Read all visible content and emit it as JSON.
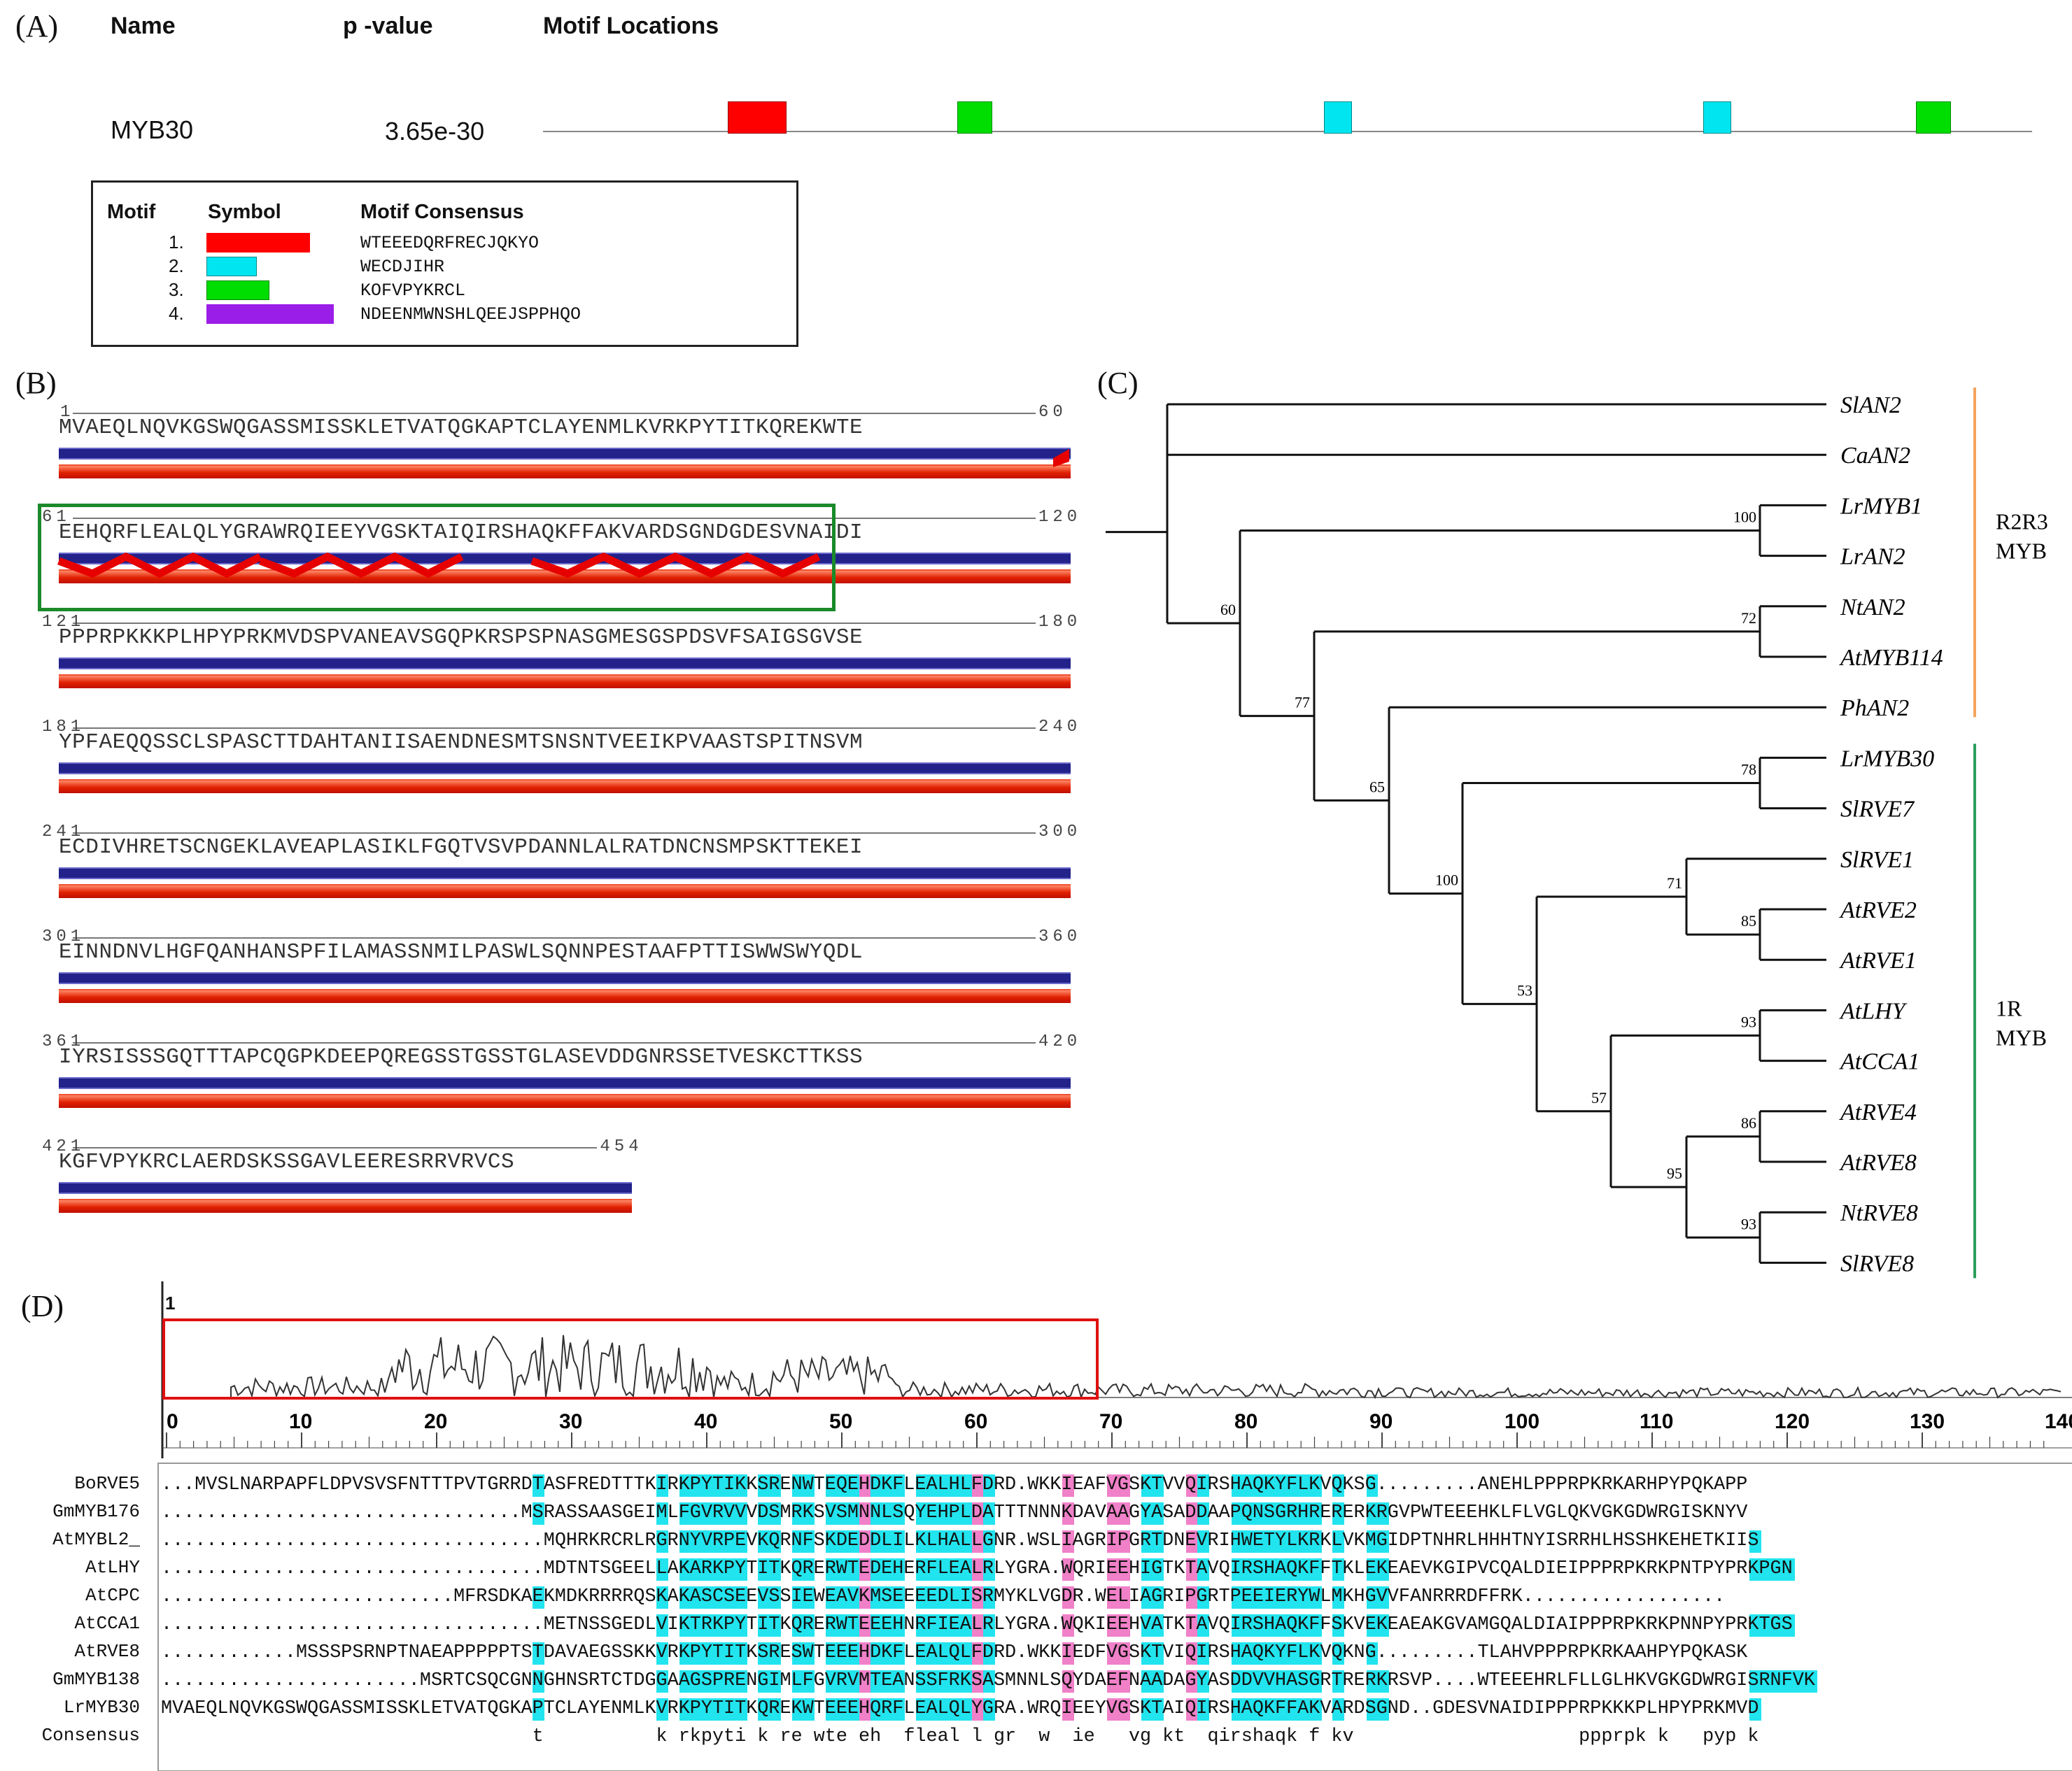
{
  "panelA": {
    "label": "(A)",
    "headers": {
      "name": "Name",
      "pvalue": "p -value",
      "locations": "Motif Locations"
    },
    "row": {
      "name": "MYB30",
      "pvalue": "3.65e-30"
    },
    "motif_blocks": [
      {
        "motif": 1,
        "color": "#ff0000"
      },
      {
        "motif": 3,
        "color": "#00dd00"
      },
      {
        "motif": 2,
        "color": "#00e5f0"
      },
      {
        "motif": 2,
        "color": "#00e5f0"
      },
      {
        "motif": 3,
        "color": "#00dd00"
      }
    ],
    "legend": {
      "headers": {
        "motif": "Motif",
        "symbol": "Symbol",
        "consensus": "Motif Consensus"
      },
      "items": [
        {
          "num": "1.",
          "color": "#ff0000",
          "consensus": "WTEEEDQRFRECJQKYO"
        },
        {
          "num": "2.",
          "color": "#00e5f0",
          "consensus": "WECDJIHR"
        },
        {
          "num": "3.",
          "color": "#00dd00",
          "consensus": "KOFVPYKRCL"
        },
        {
          "num": "4.",
          "color": "#9b1de8",
          "consensus": "NDEENMWNSHLQEEJSPPHQO"
        }
      ]
    }
  },
  "panelB": {
    "label": "(B)",
    "rows": [
      {
        "start": "1",
        "end": "60",
        "seq": "MVAEQLNQVKGSWQGASSMISSKLETVATQGKAPTCLAYENMLKVRKPYTITKQREKWTE"
      },
      {
        "start": "61",
        "end": "120",
        "seq": "EEHQRFLEALQLYGRAWRQIEEYVGSKTAIQIRSHAQKFFAKVARDSGNDGDESVNAIDI"
      },
      {
        "start": "121",
        "end": "180",
        "seq": "PPPRPKKKPLHPYPRKMVDSPVANEAVSGQPKRSPSPNASGMESGSPDSVFSAIGSGVSE"
      },
      {
        "start": "181",
        "end": "240",
        "seq": "YPFAEQQSSCLSPASCTTDAHTANIISAENDNESMTSNSNTVEEIKPVAASTSPITNSVM"
      },
      {
        "start": "241",
        "end": "300",
        "seq": "ECDIVHRETSCNGEKLAVEAPLASIKLFGQTVSVPDANNLALRATDNCNSMPSKTTEKEI"
      },
      {
        "start": "301",
        "end": "360",
        "seq": "EINNDNVLHGFQANHANSPFILAMASSNMILPASWLSQNNPESTAAFPTTISWWSWYQDL"
      },
      {
        "start": "361",
        "end": "420",
        "seq": "IYRSISSSGQTTTAPCQGPKDEEPQREGSSTGSSTGLASEVDDGNRSSETVESKCTTKSS"
      },
      {
        "start": "421",
        "end": "454",
        "seq": "KGFVPYKRCLAERDSKSSGAVLEERESRRVRVCS"
      }
    ]
  },
  "panelC": {
    "label": "(C)",
    "leaves": [
      "SlAN2",
      "CaAN2",
      "LrMYB1",
      "LrAN2",
      "NtAN2",
      "AtMYB114",
      "PhAN2",
      "LrMYB30",
      "SlRVE7",
      "SlRVE1",
      "AtRVE2",
      "AtRVE1",
      "AtLHY",
      "AtCCA1",
      "AtRVE4",
      "AtRVE8",
      "NtRVE8",
      "SlRVE8"
    ],
    "bootstrap": [
      "100",
      "72",
      "60",
      "77",
      "78",
      "65",
      "100",
      "71",
      "85",
      "53",
      "93",
      "57",
      "86",
      "95",
      "93"
    ],
    "groups": [
      {
        "label_line1": "R2R3",
        "label_line2": "MYB",
        "color": "#f4a460"
      },
      {
        "label_line1": "1R",
        "label_line2": "MYB",
        "color": "#2e9e5e"
      }
    ]
  },
  "panelD": {
    "label": "(D)",
    "start_marker": "1",
    "ticks": [
      "0",
      "10",
      "20",
      "30",
      "40",
      "50",
      "60",
      "70",
      "80",
      "90",
      "100",
      "110",
      "120",
      "130",
      "140"
    ],
    "rows": [
      {
        "name": "BoRVE5",
        "seq": "...MVSLNARPAPFLDPVSVSFNTTTPVTGRRDTASFREDTTTKIRKPYTIKKSRENWTEQEHDKFLEALHLFDRD.WKKIEAFVGSKTVVQIRSHAQKYFLKVQKSG.........ANEHLPPPRPKRKARHPYPQKAPP"
      },
      {
        "name": "GmMYB176",
        "seq": "................................MSRASSAASGEIMLFGVRVVVDSMRKSVSMNNLSQYEHPLDATTTNNNKDAVAAGYASADDAAPQNSGRHRERERKRGVPWTEEEHKLFLVGLQKVGKGDWRGISKNYV"
      },
      {
        "name": "AtMYBL2_",
        "seq": "..................................MQHRKRCRLRGRNYVRPEVKQRNFSKDEDDLILKLHALLGNR.WSLIAGRIPGRTDNEVRIHWETYLKRKLVKMGIDPTNHRLHHHTNYISRRHLHSSHKEHETKIIS"
      },
      {
        "name": "AtLHY",
        "seq": "..................................MDTNTSGEELLAKARKPYTITKQRERWTEDEHERFLEALRLYGRA.WQRIEEHIGTKTAVQIRSHAQKFFTKLEKEAEVKGIPVCQALDIEIPPPRPKRKPNTPYPRKPGN"
      },
      {
        "name": "AtCPC",
        "seq": "..........................MFRSDKAEKMDKRRRRQSKAKASCSEEVSSIEWEAVKMSEEEEDLISRMYKLVGDR.WELIAGRIPGRTPEEIERYWLMKHGVVFANRRRDFFRK.................."
      },
      {
        "name": "AtCCA1",
        "seq": "..................................METNSSGEDLVIKTRKPYTITKQRERWTEEEHNRFIEALRLYGRA.WQKIEEHVATKTAVQIRSHAQKFFSKVEKEAEAKGVAMGQALDIAIPPPRPKRKPNNPYPRKTGS"
      },
      {
        "name": "AtRVE8",
        "seq": "............MSSSPSRNPTNAEAPPPPPTSTDAVAEGSSKKVRKPYTITKSRESWTEEEHDKFLEALQLFDRD.WKKIEDFVGSKTVIQIRSHAQKYFLKVQKNG.........TLAHVPPPRPKRKAAHPYPQKASK"
      },
      {
        "name": "GmMYB138",
        "seq": ".......................MSRTCSQCGNNGHNSRTCTDGGAAGSPRENGIMLFGVRVMTEANSSFRKSASMNNLSQYDAEFNAADAGYASDDVVHASGRTRERKRSVP....WTEEEHRLFLLGLHKVGKGDWRGISRNFVK"
      },
      {
        "name": "LrMYB30",
        "seq": "MVAEQLNQVKGSWQGASSMISSKLETVATQGKAPTCLAYENMLKVRKPYTITKQREKWTEEEHQRFLEALQLYGRA.WRQIEEYVGSKTAIQIRSHAQKFFAKVARDSGND..GDESVNAIDIPPPRPKKKPLHPYPRKMVD"
      },
      {
        "name": "Consensus",
        "seq": "                                 t          k rkpyti k re wte eh  fleal l gr  w  ie   vg kt  qirshaqk f kv                    ppprpk k   pyp k   "
      }
    ]
  }
}
